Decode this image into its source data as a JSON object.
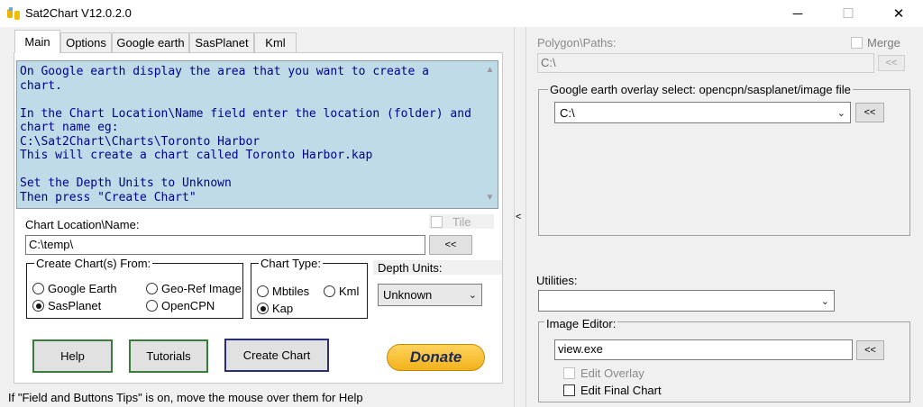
{
  "window": {
    "title": "Sat2Chart V12.0.2.0",
    "minimize_glyph": "─",
    "maximize_glyph": "☐",
    "close_glyph": "✕"
  },
  "tabs": [
    {
      "label": "Main",
      "active": true
    },
    {
      "label": "Options",
      "active": false
    },
    {
      "label": "Google earth",
      "active": false
    },
    {
      "label": "SasPlanet",
      "active": false
    },
    {
      "label": "Kml",
      "active": false
    }
  ],
  "instructions": {
    "text": "On Google earth display the area that you want to create a chart.\n\nIn the Chart Location\\Name field enter the location (folder) and chart name eg:\nC:\\Sat2Chart\\Charts\\Toronto Harbor\nThis will create a chart called Toronto Harbor.kap\n\nSet the Depth Units to Unknown\nThen press \"Create Chart\"",
    "background": "#bfdbe8",
    "text_color": "#00008b"
  },
  "chart_location": {
    "label": "Chart Location\\Name:",
    "value": "C:\\temp\\",
    "browse_label": "<<"
  },
  "tile": {
    "label": "Tile",
    "checked": false,
    "enabled": false
  },
  "create_from": {
    "title": "Create Chart(s) From:",
    "options": [
      {
        "label": "Google Earth",
        "selected": false
      },
      {
        "label": "Geo-Ref Image",
        "selected": false
      },
      {
        "label": "SasPlanet",
        "selected": true
      },
      {
        "label": "OpenCPN",
        "selected": false
      }
    ]
  },
  "chart_type": {
    "title": "Chart Type:",
    "options": [
      {
        "label": "Mbtiles",
        "selected": false
      },
      {
        "label": "Kml",
        "selected": false
      },
      {
        "label": "Kap",
        "selected": true
      }
    ]
  },
  "depth_units": {
    "label": "Depth Units:",
    "value": "Unknown"
  },
  "buttons": {
    "help": "Help",
    "tutorials": "Tutorials",
    "create_chart": "Create Chart",
    "donate": "Donate"
  },
  "status_tip": "If \"Field and Buttons Tips\" is on, move the mouse over them for Help",
  "splitter": {
    "arrow": "<"
  },
  "right": {
    "polygon_paths": {
      "label": "Polygon\\Paths:",
      "value": "C:\\",
      "browse_label": "<<"
    },
    "merge": {
      "label": "Merge",
      "checked": false,
      "enabled": false
    },
    "overlay": {
      "title": "Google earth overlay select: opencpn/sasplanet/image file",
      "value": "C:\\",
      "browse_label": "<<"
    },
    "utilities": {
      "label": "Utilities:",
      "value": ""
    },
    "image_editor": {
      "title": "Image Editor:",
      "value": "view.exe",
      "browse_label": "<<",
      "edit_overlay": {
        "label": "Edit Overlay",
        "checked": false,
        "enabled": false
      },
      "edit_final_chart": {
        "label": "Edit Final Chart",
        "checked": false,
        "enabled": true
      }
    }
  }
}
